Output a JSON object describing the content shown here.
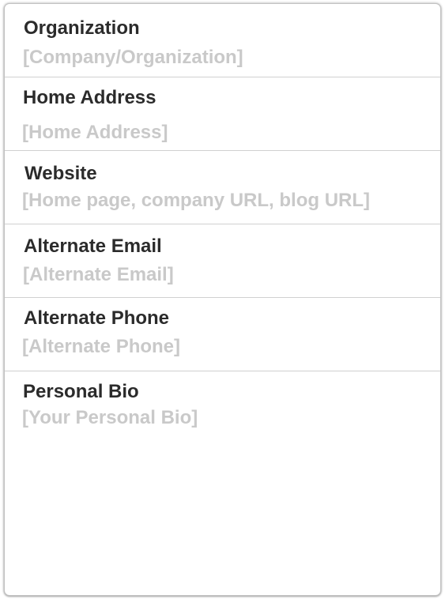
{
  "form": {
    "fields": [
      {
        "label": "Organization",
        "placeholder": "[Company/Organization]"
      },
      {
        "label": "Home Address",
        "placeholder": "[Home Address]"
      },
      {
        "label": "Website",
        "placeholder": "[Home page, company URL, blog URL]"
      },
      {
        "label": "Alternate Email",
        "placeholder": "[Alternate Email]"
      },
      {
        "label": "Alternate Phone",
        "placeholder": "[Alternate Phone]"
      },
      {
        "label": "Personal Bio",
        "placeholder": "[Your Personal Bio]"
      }
    ]
  }
}
